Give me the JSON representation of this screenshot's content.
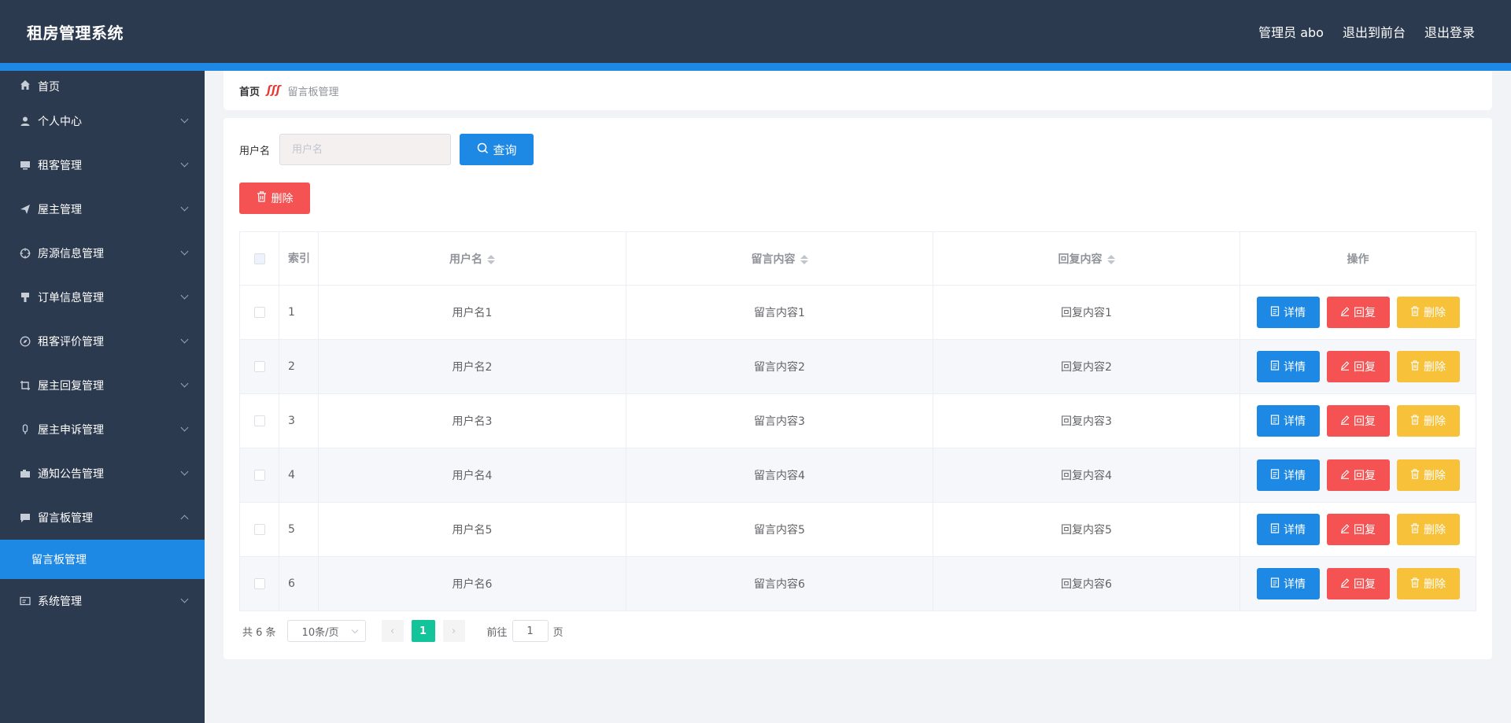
{
  "header": {
    "title": "租房管理系统",
    "admin": "管理员 abo",
    "to_front": "退出到前台",
    "logout": "退出登录"
  },
  "colors": {
    "header_bg": "#2c3a4f",
    "accent": "#1e88e5",
    "danger": "#f55353",
    "warning": "#f7c13a",
    "success": "#13c39a"
  },
  "sidebar": {
    "items": [
      {
        "label": "首页",
        "icon": "home-icon"
      },
      {
        "label": "个人中心",
        "icon": "user-icon"
      },
      {
        "label": "租客管理",
        "icon": "monitor-icon"
      },
      {
        "label": "屋主管理",
        "icon": "send-icon"
      },
      {
        "label": "房源信息管理",
        "icon": "aim-icon"
      },
      {
        "label": "订单信息管理",
        "icon": "brush-icon"
      },
      {
        "label": "租客评价管理",
        "icon": "compass-icon"
      },
      {
        "label": "屋主回复管理",
        "icon": "crop-icon"
      },
      {
        "label": "屋主申诉管理",
        "icon": "mic-icon"
      },
      {
        "label": "通知公告管理",
        "icon": "camera-icon"
      },
      {
        "label": "留言板管理",
        "icon": "chat-icon"
      },
      {
        "label": "系统管理",
        "icon": "postcard-icon"
      }
    ],
    "active_sub": "留言板管理"
  },
  "breadcrumb": {
    "home": "首页",
    "sep": "ʃʃʃ",
    "current": "留言板管理"
  },
  "search": {
    "label": "用户名",
    "placeholder": "用户名",
    "query_label": "查询"
  },
  "delete_label": "删除",
  "table": {
    "headers": {
      "index": "索引",
      "username": "用户名",
      "content": "留言内容",
      "reply": "回复内容",
      "ops": "操作"
    },
    "rows": [
      {
        "idx": "1",
        "username": "用户名1",
        "content": "留言内容1",
        "reply": "回复内容1"
      },
      {
        "idx": "2",
        "username": "用户名2",
        "content": "留言内容2",
        "reply": "回复内容2"
      },
      {
        "idx": "3",
        "username": "用户名3",
        "content": "留言内容3",
        "reply": "回复内容3"
      },
      {
        "idx": "4",
        "username": "用户名4",
        "content": "留言内容4",
        "reply": "回复内容4"
      },
      {
        "idx": "5",
        "username": "用户名5",
        "content": "留言内容5",
        "reply": "回复内容5"
      },
      {
        "idx": "6",
        "username": "用户名6",
        "content": "留言内容6",
        "reply": "回复内容6"
      }
    ],
    "ops": {
      "detail": "详情",
      "reply": "回复",
      "remove": "删除"
    }
  },
  "pagination": {
    "total": "共 6 条",
    "page_size": "10条/页",
    "current_page": "1",
    "goto_prefix": "前往",
    "goto_value": "1",
    "goto_suffix": "页"
  }
}
